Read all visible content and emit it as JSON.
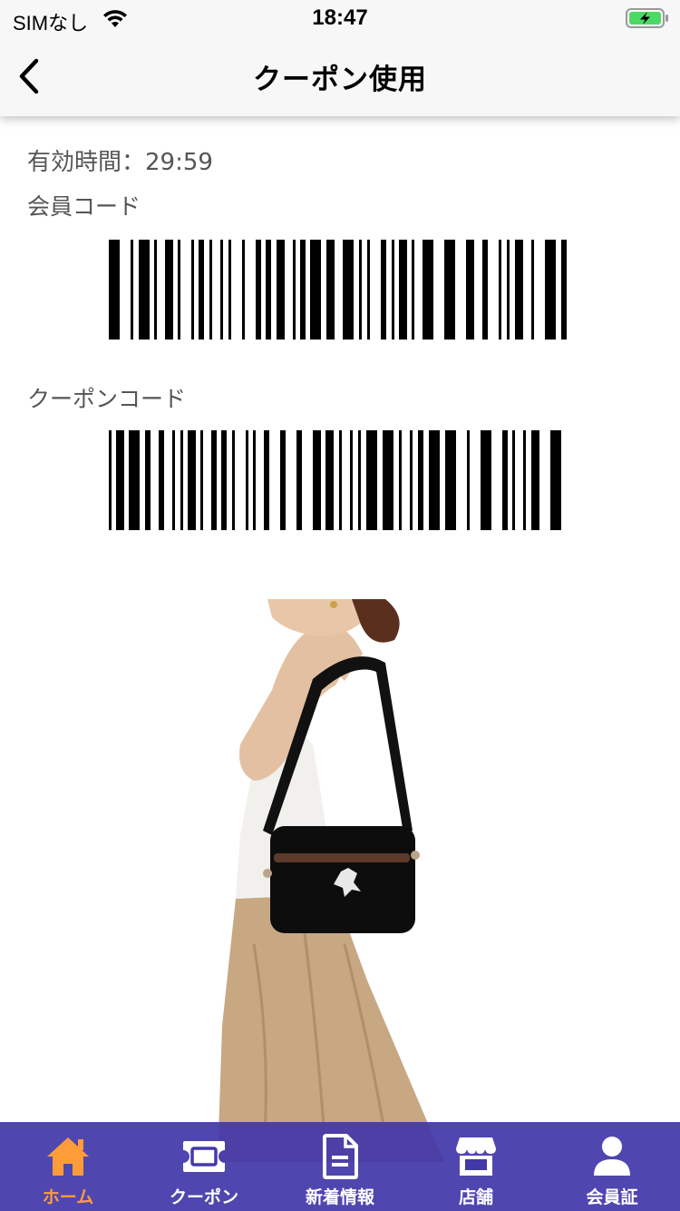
{
  "status_bar": {
    "carrier": "SIMなし",
    "time": "18:47"
  },
  "header": {
    "title": "クーポン使用",
    "back_icon": "chevron-left-icon"
  },
  "coupon": {
    "expiry_text": "有効時間：29:59",
    "member_code_label": "会員コード",
    "coupon_code_label": "クーポンコード"
  },
  "tabs": [
    {
      "label": "ホーム",
      "icon": "home-icon",
      "active": true
    },
    {
      "label": "クーポン",
      "icon": "ticket-icon",
      "active": false
    },
    {
      "label": "新着情報",
      "icon": "document-icon",
      "active": false
    },
    {
      "label": "店舗",
      "icon": "store-icon",
      "active": false
    },
    {
      "label": "会員証",
      "icon": "person-icon",
      "active": false
    }
  ],
  "colors": {
    "tab_bar_bg": "#4338aa",
    "tab_active": "#ff9c3a",
    "tab_inactive": "#ffffff",
    "text_muted": "#555555",
    "battery_charging": "#4cd964"
  }
}
